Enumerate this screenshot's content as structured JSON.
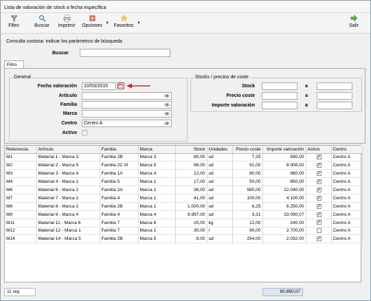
{
  "window": {
    "title": "Lista de valoración de stock a fecha específica"
  },
  "toolbar": {
    "filtro": "Filtro",
    "buscar": "Buscar",
    "imprimir": "Imprimir",
    "opciones": "Opciones",
    "favoritos": "Favoritos",
    "salir": "Salir"
  },
  "hint": "Consulta costosa: indicar los parámetros de búsqueda",
  "search": {
    "label": "Buscar",
    "value": ""
  },
  "tab": {
    "label": "Filtro"
  },
  "general": {
    "title": "General",
    "fecha_label": "Fecha valoración",
    "fecha_value": "10/03/2015",
    "articulo_label": "Artículo",
    "articulo_value": "",
    "familia_label": "Familia",
    "familia_value": "",
    "marca_label": "Marca",
    "marca_value": "",
    "centro_label": "Centro",
    "centro_value": "Centro A",
    "activo_label": "Activo",
    "activo_checked": true
  },
  "stocks": {
    "title": "Stocks / precios de coste",
    "stock_label": "Stock",
    "precio_label": "Precio coste",
    "importe_label": "Importe valoración",
    "a_label": "a"
  },
  "grid": {
    "headers": [
      "Referencia",
      "Artículo",
      "Familia",
      "Marca",
      "Stock",
      "Unidades",
      "Precio coste",
      "Importe valoración",
      "Activo",
      "Centro"
    ],
    "rows": [
      {
        "ref": "M1",
        "art": "Material 1  -  Marca 3",
        "fam": "Familia 2B",
        "marca": "Marca 3",
        "stock": "80,00",
        "ud": "ud",
        "precio": "7,25",
        "importe": "580,00",
        "activo": true,
        "centro": "Centro A"
      },
      {
        "ref": "M2",
        "art": "Material 2  -  Marca 5",
        "fam": "Familia 2C III",
        "marca": "Marca 5",
        "stock": "88,00",
        "ud": "ud",
        "precio": "91,00",
        "importe": "8.008,00",
        "activo": true,
        "centro": "Centro A"
      },
      {
        "ref": "M3",
        "art": "Material 3  -  Marca 4",
        "fam": "Familia 1A",
        "marca": "Marca 4",
        "stock": "12,00",
        "ud": "ud",
        "precio": "80,00",
        "importe": "960,00",
        "activo": true,
        "centro": "Centro A"
      },
      {
        "ref": "M4",
        "art": "Material 4  -  Marca 1",
        "fam": "Familia 5",
        "marca": "Marca 1",
        "stock": "17,00",
        "ud": "ud",
        "precio": "50,00",
        "importe": "850,00",
        "activo": true,
        "centro": "Centro A"
      },
      {
        "ref": "M6",
        "art": "Material 6  -  Marca 1",
        "fam": "Familia 2A",
        "marca": "Marca 1",
        "stock": "38,00",
        "ud": "ud",
        "precio": "580,00",
        "importe": "22.040,00",
        "activo": true,
        "centro": "Centro A"
      },
      {
        "ref": "M7",
        "art": "Material 7  -  Marca 1",
        "fam": "Familia 4",
        "marca": "Marca 1",
        "stock": "41,00",
        "ud": "ud",
        "precio": "100,00",
        "importe": "4.100,00",
        "activo": true,
        "centro": "Centro A"
      },
      {
        "ref": "M8",
        "art": "Material 8  -  Marca 1",
        "fam": "Familia 2B",
        "marca": "Marca 1",
        "stock": "1.000,00",
        "ud": "ud",
        "precio": "6,25",
        "importe": "6.250,00",
        "activo": true,
        "centro": "Centro A"
      },
      {
        "ref": "M9",
        "art": "Material 9  -  Marca 4",
        "fam": "Familia 4",
        "marca": "Marca 4",
        "stock": "9.997,00",
        "ud": "ud",
        "precio": "3,31",
        "importe": "33.090,07",
        "activo": true,
        "centro": "Centro A"
      },
      {
        "ref": "M11",
        "art": "Material 11  -  Marca 6",
        "fam": "Familia 7",
        "marca": "Marca 6",
        "stock": "20,00",
        "ud": "kg",
        "precio": "12,00",
        "importe": "240,00",
        "activo": true,
        "centro": "Centro A"
      },
      {
        "ref": "M12",
        "art": "Material 12  -  Marca 1",
        "fam": "Familia 7",
        "marca": "Marca 1",
        "stock": "30,00",
        "ud": "l",
        "precio": "90,00",
        "importe": "2.700,00",
        "activo": false,
        "centro": "Centro A"
      },
      {
        "ref": "M14",
        "art": "Material 14  -  Marca 5",
        "fam": "Familia 2B",
        "marca": "Marca 5",
        "stock": "8,00",
        "ud": "ud",
        "precio": "254,00",
        "importe": "2.032,00",
        "activo": true,
        "centro": "Centro A"
      }
    ]
  },
  "status": {
    "count": "11 reg",
    "total": "80.850,07"
  },
  "colors": {
    "arrow": "#c0282d",
    "total_bg": "#dbe5f3",
    "border": "#8a9bb3"
  }
}
